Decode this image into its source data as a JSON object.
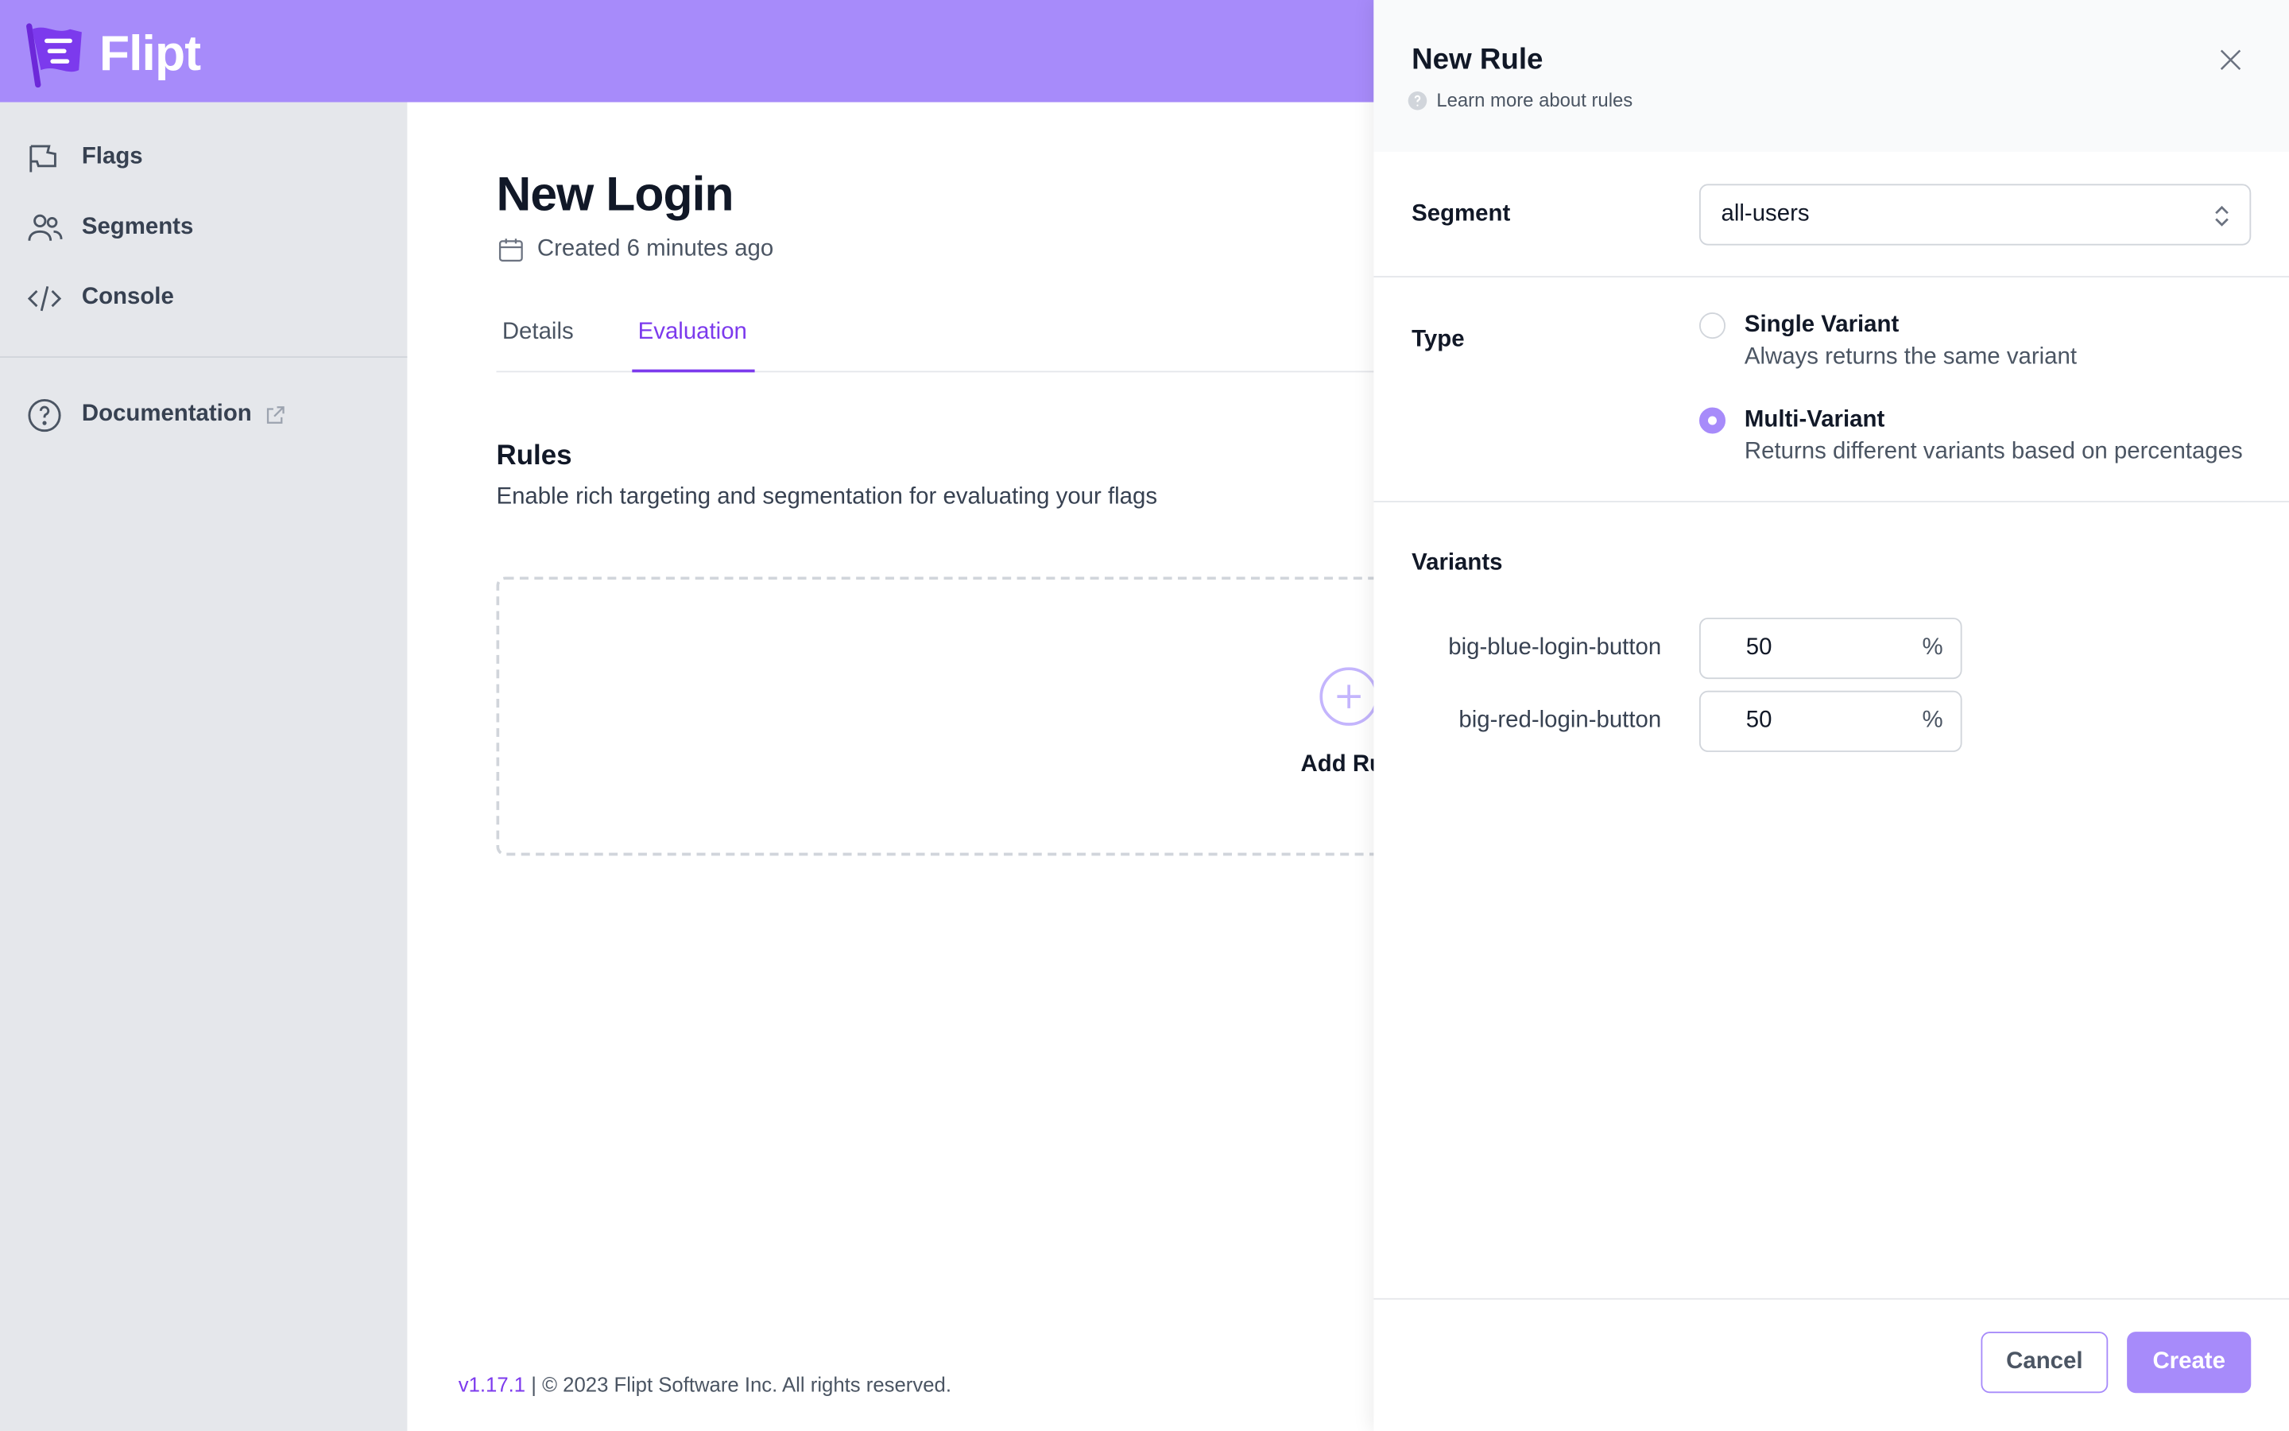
{
  "app": {
    "name": "Flipt",
    "brand_color": "#a78bfa",
    "accent_color": "#7c3aed"
  },
  "sidebar": {
    "items": [
      {
        "label": "Flags",
        "icon": "flag-icon"
      },
      {
        "label": "Segments",
        "icon": "users-icon"
      },
      {
        "label": "Console",
        "icon": "code-icon"
      }
    ],
    "documentation": {
      "label": "Documentation",
      "icon": "help-circle-icon",
      "external_icon": "external-link-icon"
    }
  },
  "main": {
    "title": "New Login",
    "created": "Created 6 minutes ago",
    "tabs": [
      {
        "label": "Details",
        "active": false
      },
      {
        "label": "Evaluation",
        "active": true
      }
    ],
    "rules": {
      "title": "Rules",
      "subtitle": "Enable rich targeting and segmentation for evaluating your flags",
      "add_label": "Add Ru"
    },
    "footer": {
      "version": "v1.17.1",
      "copyright": " | © 2023 Flipt Software Inc. All rights reserved."
    }
  },
  "panel": {
    "title": "New Rule",
    "learn_more": "Learn more about rules",
    "segment": {
      "label": "Segment",
      "value": "all-users"
    },
    "type": {
      "label": "Type",
      "options": [
        {
          "title": "Single Variant",
          "description": "Always returns the same variant",
          "selected": false
        },
        {
          "title": "Multi-Variant",
          "description": "Returns different variants based on percentages",
          "selected": true
        }
      ]
    },
    "variants": {
      "label": "Variants",
      "items": [
        {
          "name": "big-blue-login-button",
          "value": "50",
          "unit": "%"
        },
        {
          "name": "big-red-login-button",
          "value": "50",
          "unit": "%"
        }
      ]
    },
    "buttons": {
      "cancel": "Cancel",
      "create": "Create"
    }
  }
}
